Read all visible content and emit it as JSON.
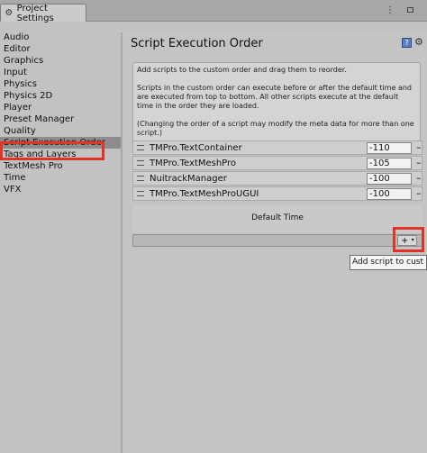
{
  "window": {
    "tab_title": "Project Settings",
    "tab_icon": "gear-icon",
    "menu_icon": "kebab-menu-icon",
    "maximize_icon": "maximize-icon"
  },
  "sidebar": {
    "items": [
      {
        "label": "Audio"
      },
      {
        "label": "Editor"
      },
      {
        "label": "Graphics"
      },
      {
        "label": "Input"
      },
      {
        "label": "Physics"
      },
      {
        "label": "Physics 2D"
      },
      {
        "label": "Player"
      },
      {
        "label": "Preset Manager"
      },
      {
        "label": "Quality"
      },
      {
        "label": "Script Execution Order"
      },
      {
        "label": "Tags and Layers"
      },
      {
        "label": "TextMesh Pro"
      },
      {
        "label": "Time"
      },
      {
        "label": "VFX"
      }
    ],
    "selected_index": 9
  },
  "main": {
    "title": "Script Execution Order",
    "help_icon": "help-book-icon",
    "settings_icon": "settings-gear-icon",
    "help_text": [
      "Add scripts to the custom order and drag them to reorder.",
      "Scripts in the custom order can execute before or after the default time and are executed from top to bottom. All other scripts execute at the default time in the order they are loaded.",
      "(Changing the order of a script may modify the meta data for more than one script.)"
    ],
    "scripts": [
      {
        "name": "TMPro.TextContainer",
        "order": "-110",
        "remove": "–"
      },
      {
        "name": "TMPro.TextMeshPro",
        "order": "-105",
        "remove": "–"
      },
      {
        "name": "NuitrackManager",
        "order": "-100",
        "remove": "–"
      },
      {
        "name": "TMPro.TextMeshProUGUI",
        "order": "-100",
        "remove": "–"
      }
    ],
    "default_time_label": "Default Time",
    "add_button_label": "+",
    "add_button_caret": "▾",
    "tooltip": "Add script to cust"
  },
  "colors": {
    "highlight": "#e2332a",
    "selected_bg": "#8d8d8d"
  }
}
